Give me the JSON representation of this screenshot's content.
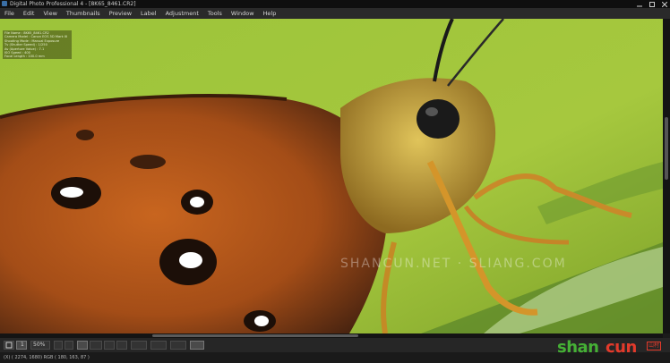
{
  "window": {
    "title": "Digital Photo Professional 4 - [8K65_8461.CR2]"
  },
  "menu": [
    "File",
    "Edit",
    "View",
    "Thumbnails",
    "Preview",
    "Label",
    "Adjustment",
    "Tools",
    "Window",
    "Help"
  ],
  "shooting_info": [
    "File Name : 8K65_8461.CR2",
    "Camera Model : Canon EOS 5D Mark III",
    "Shooting Mode : Manual Exposure",
    "Tv (Shutter Speed) : 1/250",
    "Av (Aperture Value) : 7.1",
    "ISO Speed : 400",
    "Focal Length : 100.0 mm"
  ],
  "watermark": "SHANCUN.NET · SLIANG.COM",
  "toolbar": {
    "page_num": "1",
    "zoom": "50%"
  },
  "status_text": "(X) ( 2274, 1680) RGB ( 180, 163, 87 )",
  "logo": {
    "part1": "shan",
    "part2": "cun",
    "part3": "山村"
  },
  "colors": {
    "background": "#8fb52e",
    "wing": "#b5561c",
    "logo_green": "#45b035",
    "logo_red": "#e33a2b"
  }
}
